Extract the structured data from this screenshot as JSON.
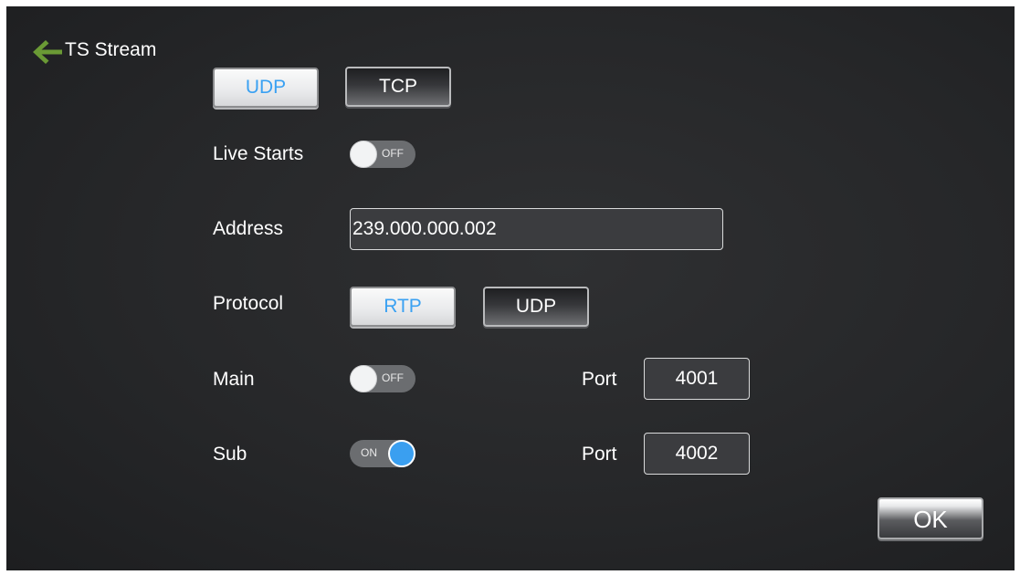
{
  "header": {
    "title": "TS Stream",
    "back_icon": "arrow-left-icon",
    "back_icon_color": "#6a9a35"
  },
  "transport": {
    "options": [
      "UDP",
      "TCP"
    ],
    "selected": "UDP"
  },
  "live_starts": {
    "label": "Live Starts",
    "state": "OFF"
  },
  "address": {
    "label": "Address",
    "value": "239.000.000.002"
  },
  "protocol": {
    "label": "Protocol",
    "options": [
      "RTP",
      "UDP"
    ],
    "selected": "RTP"
  },
  "main": {
    "label": "Main",
    "state": "OFF",
    "port_label": "Port",
    "port_value": "4001"
  },
  "sub": {
    "label": "Sub",
    "state": "ON",
    "port_label": "Port",
    "port_value": "4002"
  },
  "ok_label": "OK",
  "colors": {
    "accent": "#3aa1f2",
    "background": "#2a2b2d"
  }
}
